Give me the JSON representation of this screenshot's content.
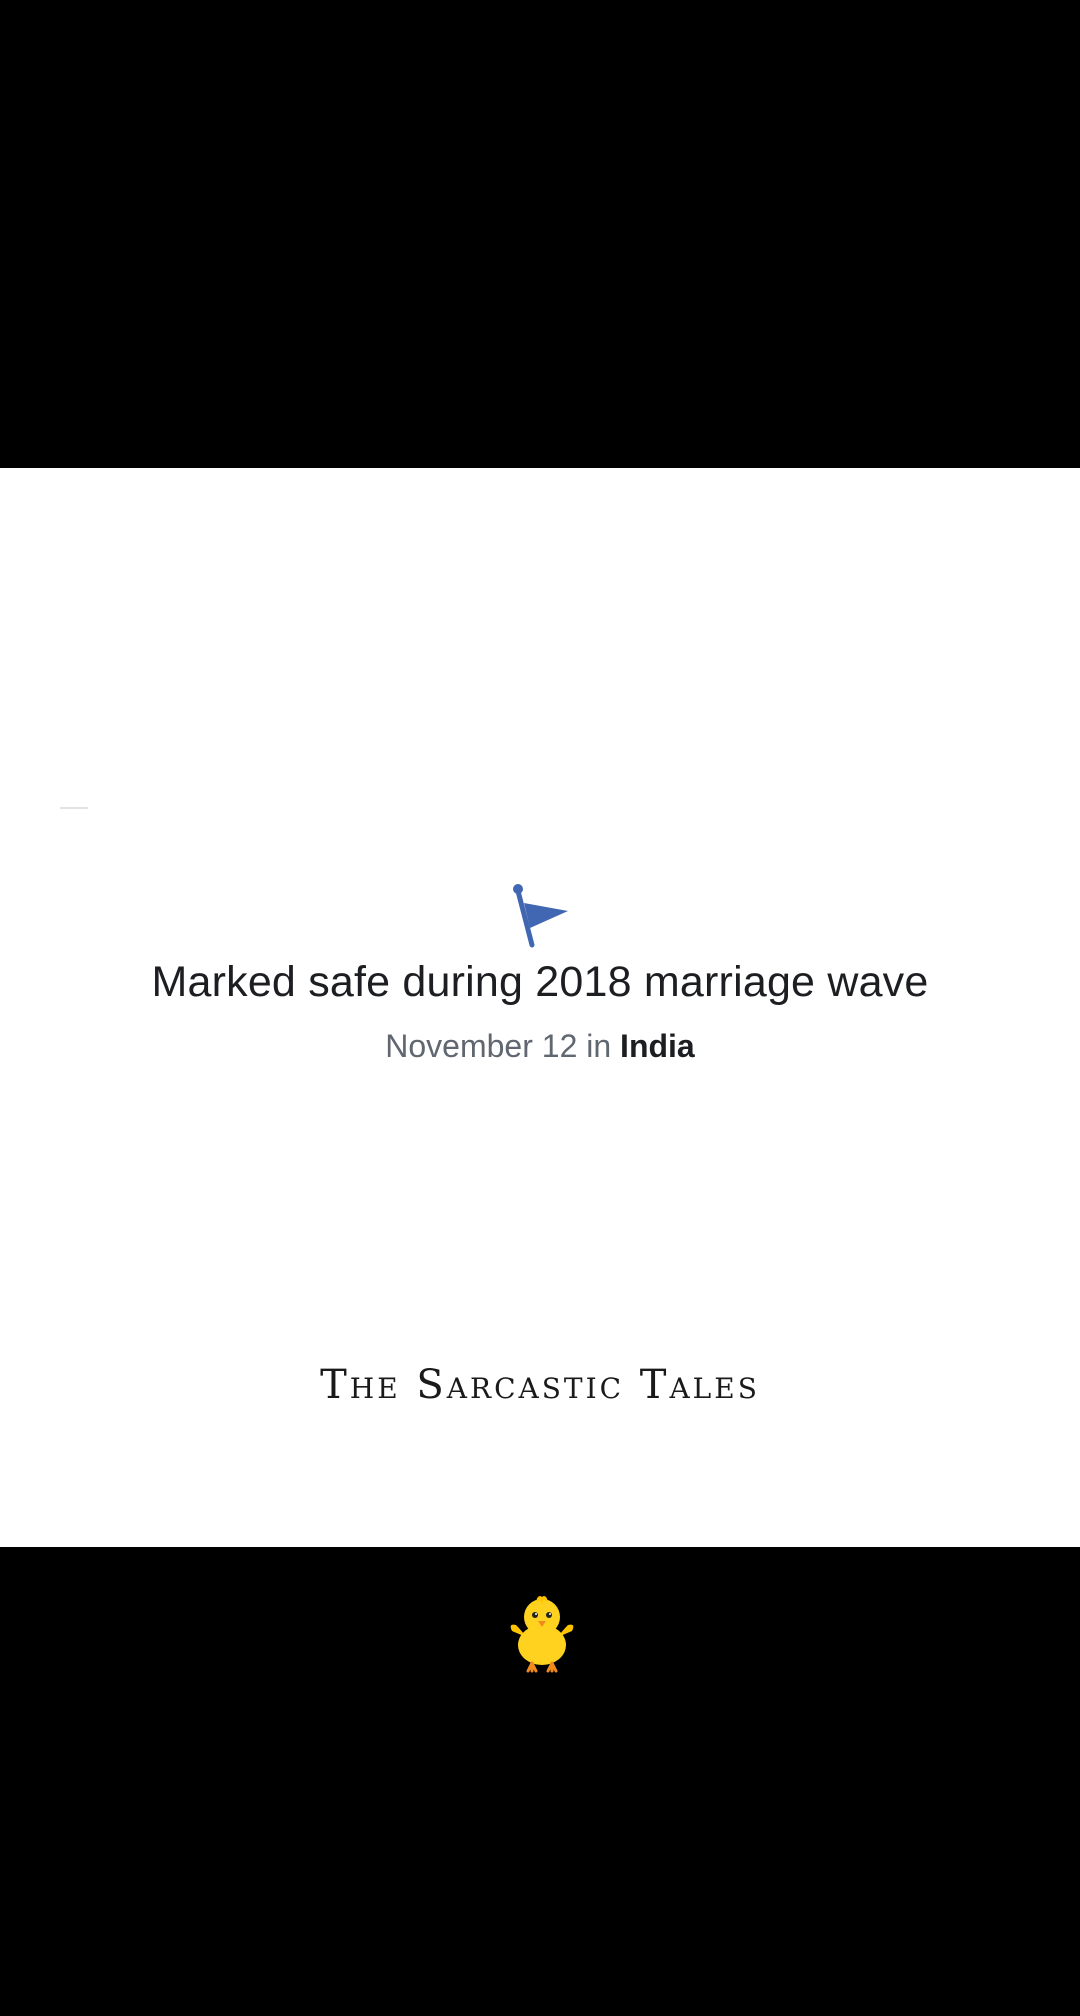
{
  "post": {
    "headline": "Marked safe during 2018 marriage wave",
    "date": "November 12",
    "connector": "in",
    "location": "India",
    "flag_icon": "flag-icon",
    "flag_color": "#4267b2"
  },
  "watermark": {
    "text": "The Sarcastic Tales"
  },
  "sticker": {
    "icon": "chick-icon",
    "color": "#ffd21f"
  }
}
